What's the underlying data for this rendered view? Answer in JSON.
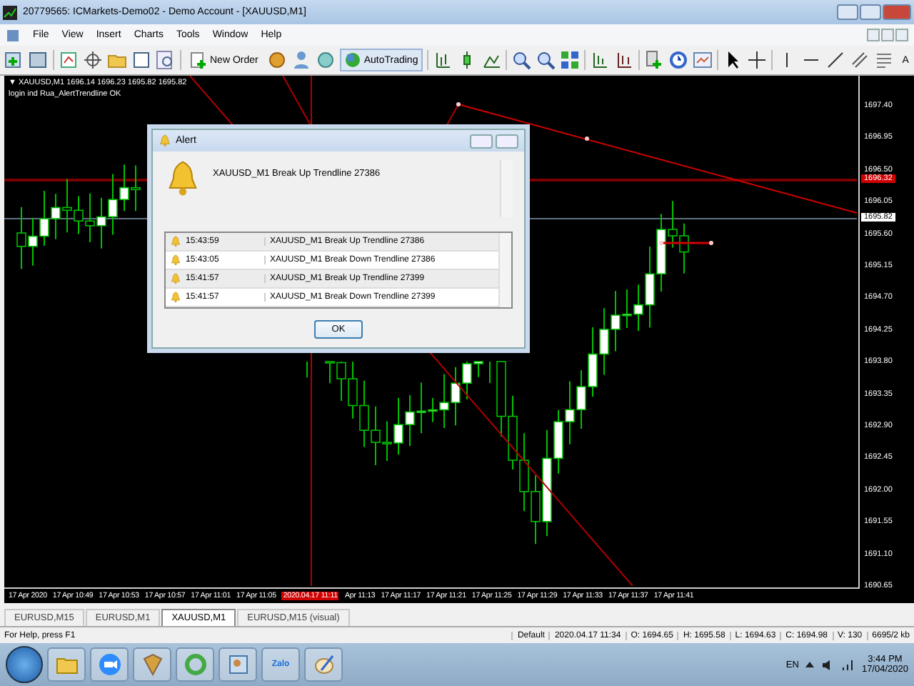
{
  "window": {
    "title": "20779565: ICMarkets-Demo02 - Demo Account - [XAUUSD,M1]"
  },
  "menu": [
    "File",
    "View",
    "Insert",
    "Charts",
    "Tools",
    "Window",
    "Help"
  ],
  "toolbar": {
    "new_order": "New Order",
    "autotrading": {
      "label": "AutoTrading",
      "on": true
    },
    "text_tool": "A"
  },
  "chart": {
    "header": "▼ XAUUSD,M1  1696.14 1696.23 1695.82 1695.82",
    "indicator_status": "login ind Rua_AlertTrendline OK",
    "price_axis": [
      "1697.40",
      "1696.95",
      "1696.50",
      "1696.05",
      "1695.60",
      "1695.15",
      "1694.70",
      "1694.25",
      "1693.80",
      "1693.35",
      "1692.90",
      "1692.45",
      "1692.00",
      "1691.55",
      "1691.10",
      "1690.65"
    ],
    "alert_price": "1696.32",
    "bid_price": "1695.82",
    "time_axis": [
      {
        "label": "17 Apr 2020",
        "kind": "tick"
      },
      {
        "label": "17 Apr 10:49",
        "kind": "tick"
      },
      {
        "label": "17 Apr 10:53",
        "kind": "tick"
      },
      {
        "label": "17 Apr 10:57",
        "kind": "tick"
      },
      {
        "label": "17 Apr 11:01",
        "kind": "tick"
      },
      {
        "label": "17 Apr 11:05",
        "kind": "tick"
      },
      {
        "label": "2020.04.17 11:11",
        "kind": "cursor"
      },
      {
        "label": "Apr 11:13",
        "kind": "tick"
      },
      {
        "label": "17 Apr 11:17",
        "kind": "tick"
      },
      {
        "label": "17 Apr 11:21",
        "kind": "tick"
      },
      {
        "label": "17 Apr 11:25",
        "kind": "tick"
      },
      {
        "label": "17 Apr 11:29",
        "kind": "tick"
      },
      {
        "label": "17 Apr 11:33",
        "kind": "tick"
      },
      {
        "label": "17 Apr 11:37",
        "kind": "tick"
      },
      {
        "label": "17 Apr 11:41",
        "kind": "tick"
      }
    ]
  },
  "alert_dialog": {
    "title": "Alert",
    "message": "XAUUSD_M1  Break Up Trendline 27386",
    "history": [
      {
        "time": "15:43:59",
        "message": "XAUUSD_M1  Break Up Trendline 27386"
      },
      {
        "time": "15:43:05",
        "message": "XAUUSD_M1  Break Down Trendline 27386"
      },
      {
        "time": "15:41:57",
        "message": "XAUUSD_M1  Break Up Trendline 27399"
      },
      {
        "time": "15:41:57",
        "message": "XAUUSD_M1  Break Down Trendline 27399"
      }
    ],
    "button": "OK"
  },
  "tabs": [
    {
      "label": "EURUSD,M15",
      "selected": false
    },
    {
      "label": "EURUSD,M1",
      "selected": false
    },
    {
      "label": "XAUUSD,M1",
      "selected": true
    },
    {
      "label": "EURUSD,M15 (visual)",
      "selected": false
    }
  ],
  "status_bar": [
    "For Help, press F1",
    "Default",
    "2020.04.17 11:34",
    "O: 1694.65",
    "H: 1695.58",
    "L: 1694.63",
    "C: 1694.98",
    "V: 130",
    "6695/2 kb"
  ],
  "taskbar": {
    "app_label": "Zalo",
    "language": "EN",
    "time": "3:44 PM",
    "date": "17/04/2020"
  }
}
